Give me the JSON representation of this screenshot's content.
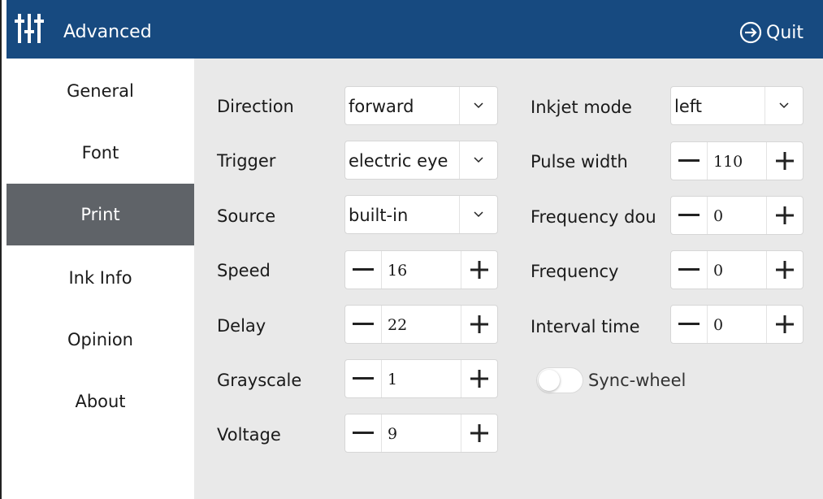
{
  "header": {
    "title": "Advanced",
    "quit_label": "Quit",
    "background_color": "#174a80"
  },
  "sidebar": {
    "active_color": "#5f6368",
    "items": [
      {
        "label": "General",
        "active": false
      },
      {
        "label": "Font",
        "active": false
      },
      {
        "label": "Print",
        "active": true
      },
      {
        "label": "Ink Info",
        "active": false
      },
      {
        "label": "Opinion",
        "active": false
      },
      {
        "label": "About",
        "active": false
      }
    ]
  },
  "print": {
    "direction": {
      "label": "Direction",
      "value": "forward"
    },
    "trigger": {
      "label": "Trigger",
      "value": "electric eye"
    },
    "source": {
      "label": "Source",
      "value": "built-in"
    },
    "speed": {
      "label": "Speed",
      "value": "16"
    },
    "delay": {
      "label": "Delay",
      "value": "22"
    },
    "grayscale": {
      "label": "Grayscale",
      "value": "1"
    },
    "voltage": {
      "label": "Voltage",
      "value": "9"
    },
    "inkjet_mode": {
      "label": "Inkjet mode",
      "value": "left"
    },
    "pulse_width": {
      "label": "Pulse width",
      "value": "110"
    },
    "frequency_double": {
      "label": "Frequency dou",
      "value": "0"
    },
    "frequency": {
      "label": "Frequency",
      "value": "0"
    },
    "interval_time": {
      "label": "Interval time",
      "value": "0"
    },
    "sync_wheel": {
      "label": "Sync-wheel",
      "enabled": false
    }
  },
  "icons": {
    "logo": "sliders-icon",
    "quit": "exit-icon",
    "dropdown": "chevron-down-icon",
    "decrement": "minus-icon",
    "increment": "plus-icon"
  }
}
